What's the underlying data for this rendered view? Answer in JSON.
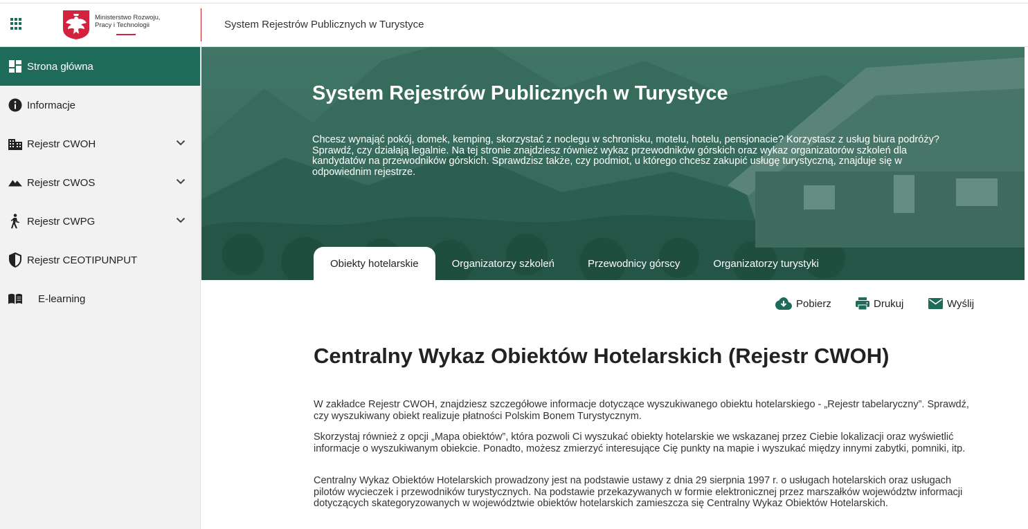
{
  "header": {
    "logo_text_line1": "Ministerstwo Rozwoju,",
    "logo_text_line2": "Pracy i Technologii",
    "title": "System Rejestrów Publicznych w Turystyce"
  },
  "sidebar": {
    "items": [
      {
        "label": "Strona główna",
        "icon": "dashboard-icon"
      },
      {
        "label": "Informacje",
        "icon": "info-icon"
      },
      {
        "label": "Rejestr CWOH",
        "icon": "building-icon"
      },
      {
        "label": "Rejestr CWOS",
        "icon": "mountain-icon"
      },
      {
        "label": "Rejestr CWPG",
        "icon": "hiker-icon"
      },
      {
        "label": "Rejestr CEOTIPUNPUT",
        "icon": "shield-icon"
      },
      {
        "label": "E-learning",
        "icon": "book-icon"
      }
    ]
  },
  "hero": {
    "title": "System Rejestrów Publicznych w Turystyce",
    "text": "Chcesz wynająć pokój, domek, kemping, skorzystać z noclegu w schronisku, motelu, hotelu, pensjonacie? Korzystasz z usług biura podróży? Sprawdź, czy działają legalnie. Na tej stronie znajdziesz również wykaz przewodników górskich oraz wykaz organizatorów szkoleń dla kandydatów na przewodników górskich. Sprawdzisz także, czy podmiot, u którego chcesz zakupić usługę turystyczną, znajduje się w odpowiednim rejestrze."
  },
  "tabs": [
    "Obiekty hotelarskie",
    "Organizatorzy szkoleń",
    "Przewodnicy górscy",
    "Organizatorzy turystyki"
  ],
  "actions": {
    "download": "Pobierz",
    "print": "Drukuj",
    "send": "Wyślij"
  },
  "content": {
    "heading": "Centralny Wykaz Obiektów Hotelarskich (Rejestr CWOH)",
    "p1": "W zakładce Rejestr CWOH, znajdziesz szczegółowe informacje dotyczące wyszukiwanego obiektu hotelarskiego - „Rejestr tabelaryczny”. Sprawdź, czy wyszukiwany obiekt realizuje płatności Polskim Bonem Turystycznym.",
    "p2": "Skorzystaj również z opcji „Mapa obiektów”, która pozwoli Ci wyszukać obiekty hotelarskie we wskazanej przez Ciebie lokalizacji oraz wyświetlić informacje o wyszukiwanym obiekcie. Ponadto, możesz zmierzyć interesujące Cię punkty na mapie i wyszukać między innymi zabytki, pomniki, itp.",
    "p3": "Centralny Wykaz Obiektów Hotelarskich prowadzony jest  na podstawie ustawy z dnia 29 sierpnia 1997 r. o usługach hotelarskich oraz usługach pilotów wycieczek i przewodników turystycznych. Na podstawie przekazywanych w formie elektronicznej przez marszałków województw informacji dotyczących skategoryzowanych w województwie obiektów hotelarskich zamieszcza się Centralny Wykaz Obiektów Hotelarskich."
  },
  "colors": {
    "brand": "#1e6b5a",
    "accent_red": "#d4213d"
  }
}
